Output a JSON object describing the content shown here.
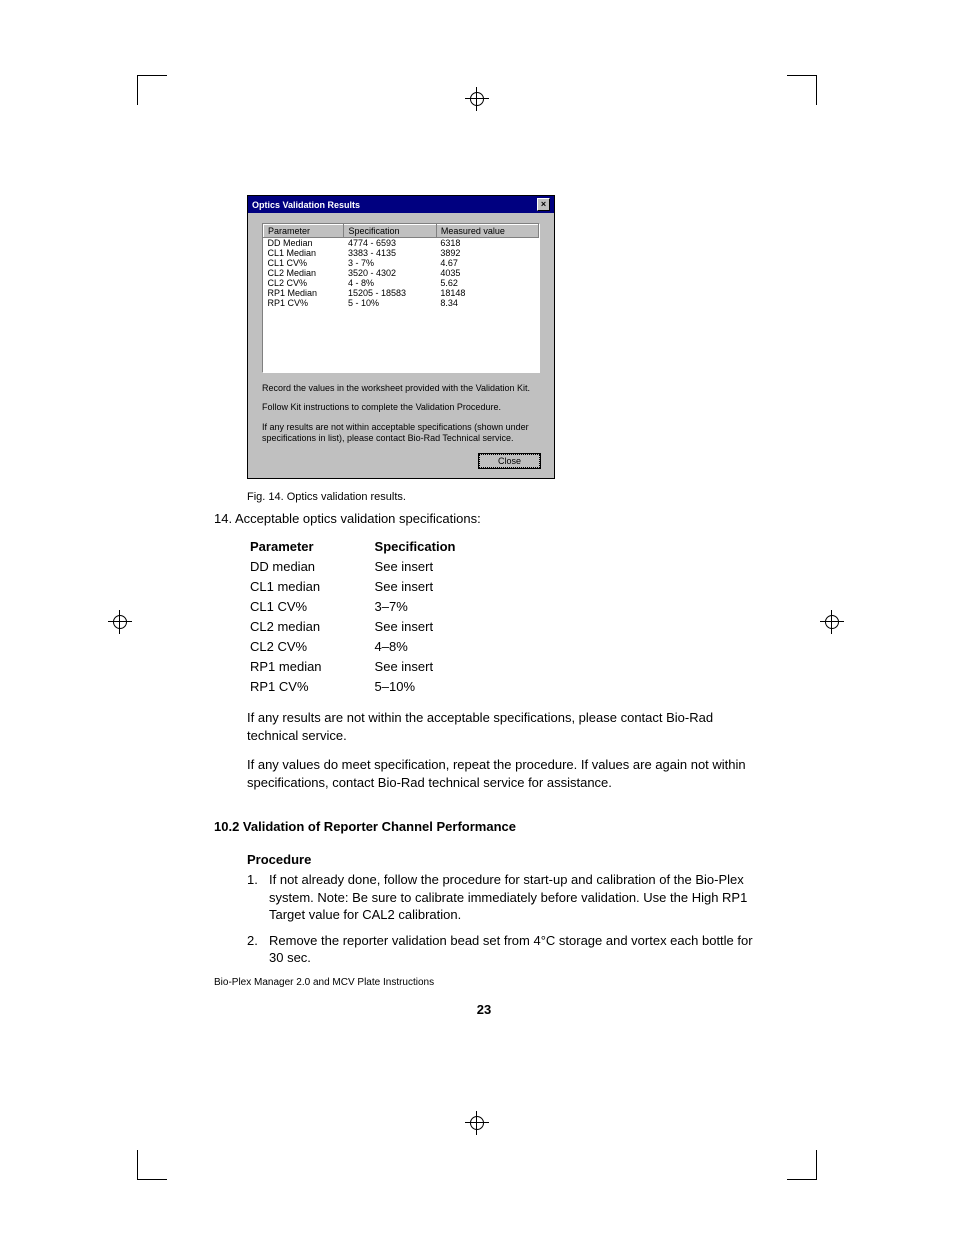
{
  "dialog": {
    "title": "Optics Validation Results",
    "close_label": "×",
    "headers": {
      "param": "Parameter",
      "spec": "Specification",
      "meas": "Measured value"
    },
    "rows": [
      {
        "param": "DD Median",
        "spec": "4774 - 6593",
        "meas": "6318"
      },
      {
        "param": "CL1 Median",
        "spec": "3383 - 4135",
        "meas": "3892"
      },
      {
        "param": "CL1 CV%",
        "spec": "3 - 7%",
        "meas": "4.67"
      },
      {
        "param": "CL2 Median",
        "spec": "3520 - 4302",
        "meas": "4035"
      },
      {
        "param": "CL2 CV%",
        "spec": "4 - 8%",
        "meas": "5.62"
      },
      {
        "param": "RP1 Median",
        "spec": "15205 - 18583",
        "meas": "18148"
      },
      {
        "param": "RP1 CV%",
        "spec": "5 - 10%",
        "meas": "8.34"
      }
    ],
    "text1": "Record the values in the worksheet provided with the Validation Kit.",
    "text2": "Follow Kit instructions to complete the Validation Procedure.",
    "text3": "If any results are not within acceptable specifications (shown under specifications in list), please contact Bio-Rad Technical service.",
    "close_btn": "Close"
  },
  "fig_caption": "Fig. 14.  Optics validation results.",
  "list14_num": "14.",
  "list14_text": "Acceptable optics validation specifications:",
  "spec": {
    "h_param": "Parameter",
    "h_spec": "Specification",
    "rows": [
      {
        "p": "DD median",
        "s": "See insert"
      },
      {
        "p": "CL1 median",
        "s": "See insert"
      },
      {
        "p": "CL1 CV%",
        "s": "3–7%"
      },
      {
        "p": "CL2 median",
        "s": "See insert"
      },
      {
        "p": "CL2 CV%",
        "s": "4–8%"
      },
      {
        "p": "RP1 median",
        "s": "See insert"
      },
      {
        "p": "RP1 CV%",
        "s": "5–10%"
      }
    ]
  },
  "para1": "If any results are not within the acceptable specifications, please contact Bio-Rad technical service.",
  "para2": "If any values do meet specification, repeat the procedure. If values are again not within specifications, contact Bio-Rad technical service for assistance.",
  "section_heading": "10.2  Validation of Reporter Channel Performance",
  "procedure_heading": "Procedure",
  "procedure": [
    {
      "n": "1.",
      "t": "If not already done, follow the procedure for start-up and calibration of the Bio-Plex system. Note:  Be sure to calibrate immediately before validation. Use the High RP1 Target value for CAL2 calibration."
    },
    {
      "n": "2.",
      "t": "Remove the reporter validation bead set from 4°C storage and vortex each bottle for 30 sec."
    }
  ],
  "footer": "Bio-Plex Manager 2.0 and MCV Plate Instructions",
  "page_number": "23"
}
